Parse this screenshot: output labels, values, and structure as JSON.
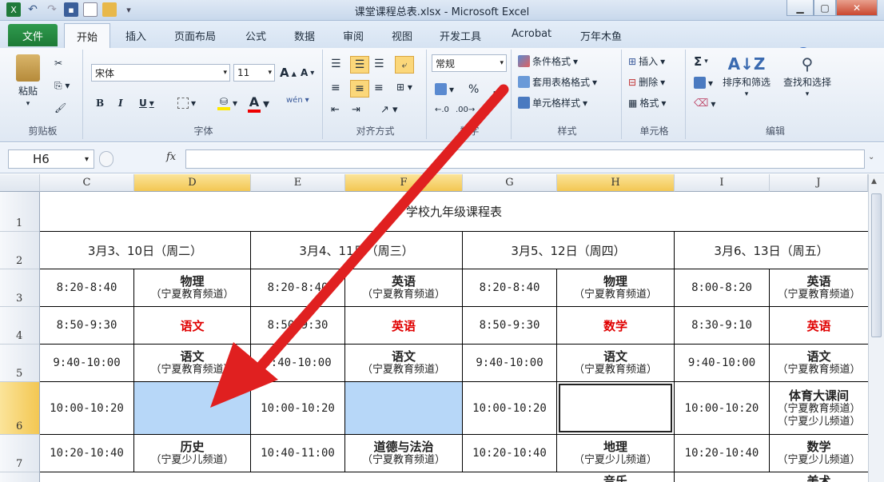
{
  "window": {
    "title": "课堂课程总表.xlsx - Microsoft Excel"
  },
  "tabs": {
    "file": "文件",
    "home": "开始",
    "others": [
      "插入",
      "页面布局",
      "公式",
      "数据",
      "审阅",
      "视图",
      "开发工具",
      "Acrobat",
      "万年木鱼"
    ]
  },
  "ribbon": {
    "clipboard": {
      "label": "剪贴板",
      "paste": "粘贴"
    },
    "font": {
      "label": "字体",
      "name": "宋体",
      "size": "11",
      "bold": "B",
      "italic": "I",
      "underline": "U",
      "grow": "A",
      "shrink": "A",
      "wen": "wén"
    },
    "align": {
      "label": "对齐方式"
    },
    "number": {
      "label": "数字",
      "format": "常规",
      "percent": "%",
      "comma": ","
    },
    "styles": {
      "label": "样式",
      "cond": "条件格式",
      "table": "套用表格格式",
      "cell": "单元格样式"
    },
    "cells": {
      "label": "单元格",
      "insert": "插入",
      "delete": "删除",
      "format": "格式"
    },
    "edit": {
      "label": "编辑",
      "sigma": "Σ",
      "sort": "排序和筛选",
      "find": "查找和选择"
    }
  },
  "formula": {
    "namebox": "H6",
    "fx": "fx",
    "value": ""
  },
  "sheet": {
    "columns": [
      "C",
      "D",
      "E",
      "F",
      "G",
      "H",
      "I",
      "J"
    ],
    "rows": [
      "1",
      "2",
      "3",
      "4",
      "5",
      "6",
      "7"
    ],
    "title": "学校九年级课程表",
    "days": [
      "3月3、10日（周二）",
      "3月4、11日（周三）",
      "3月5、12日（周四）",
      "3月6、13日（周五）"
    ],
    "r3": {
      "t1": "8:20-8:40",
      "s1": "物理",
      "c1": "（宁夏教育频道）",
      "t2": "8:20-8:40",
      "s2": "英语",
      "c2": "（宁夏教育频道）",
      "t3": "8:20-8:40",
      "s3": "物理",
      "c3": "（宁夏教育频道）",
      "t4": "8:00-8:20",
      "s4": "英语",
      "c4": "（宁夏教育频道）"
    },
    "r4": {
      "t1": "8:50-9:30",
      "s1": "语文",
      "t2": "8:50-9:30",
      "s2": "英语",
      "t3": "8:50-9:30",
      "s3": "数学",
      "t4": "8:30-9:10",
      "s4": "英语"
    },
    "r5": {
      "t1": "9:40-10:00",
      "s1": "语文",
      "c1": "（宁夏教育频道）",
      "t2": "9:40-10:00",
      "s2": "语文",
      "c2": "（宁夏教育频道）",
      "t3": "9:40-10:00",
      "s3": "语文",
      "c3": "（宁夏教育频道）",
      "t4": "9:40-10:00",
      "s4": "语文",
      "c4": "（宁夏教育频道）"
    },
    "r6": {
      "t1": "10:00-10:20",
      "t2": "10:00-10:20",
      "t3": "10:00-10:20",
      "t4": "10:00-10:20",
      "s4": "体育大课间",
      "c4a": "（宁夏教育频道）",
      "c4b": "（宁夏少儿频道）"
    },
    "r7": {
      "t1": "10:20-10:40",
      "s1": "历史",
      "c1": "（宁夏少儿频道）",
      "t2": "10:40-11:00",
      "s2": "道德与法治",
      "c2": "（宁夏教育频道）",
      "t3": "10:20-10:40",
      "s3": "地理",
      "c3": "（宁夏少儿频道）",
      "t4": "10:20-10:40",
      "s4": "数学",
      "c4": "（宁夏少儿频道）"
    },
    "r8": {
      "s3": "音乐",
      "s4": "美术"
    }
  },
  "colors": {
    "selected_col": "#f3c752",
    "highlight_cell": "#b7d7f8",
    "red_text": "#e00000",
    "arrow": "#e02020",
    "file_tab": "#2a8c44"
  }
}
